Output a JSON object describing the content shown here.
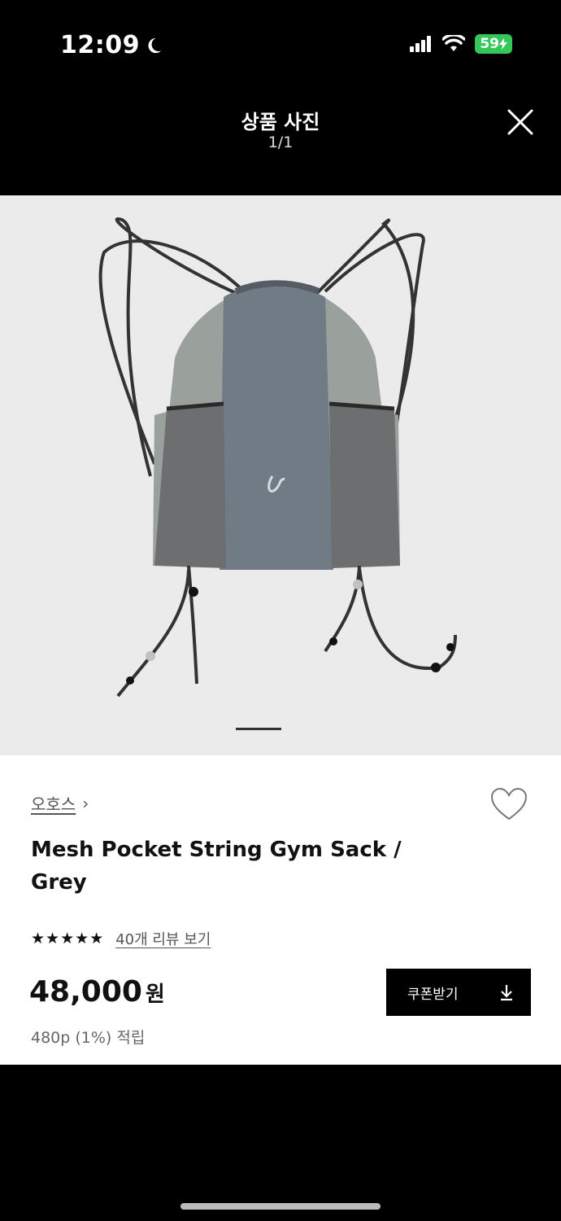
{
  "status_bar": {
    "time": "12:09",
    "battery": "59"
  },
  "header": {
    "title": "상품 사진",
    "counter": "1/1"
  },
  "product": {
    "brand": "오호스",
    "brand_chevron": "›",
    "name": "Mesh Pocket String Gym Sack / Grey",
    "stars": "★★★★★",
    "rating_value": 5,
    "reviews_link": "40개 리뷰 보기",
    "price": "48,000",
    "currency": "원",
    "points": "480p (1%) 적립",
    "coupon_label": "쿠폰받기"
  },
  "icons": {
    "close": "close-icon",
    "heart": "heart-icon",
    "download": "download-icon",
    "moon": "moon-icon",
    "signal": "signal-icon",
    "wifi": "wifi-icon"
  },
  "colors": {
    "background": "#000000",
    "image_bg": "#ebebeb",
    "battery": "#34c759"
  }
}
